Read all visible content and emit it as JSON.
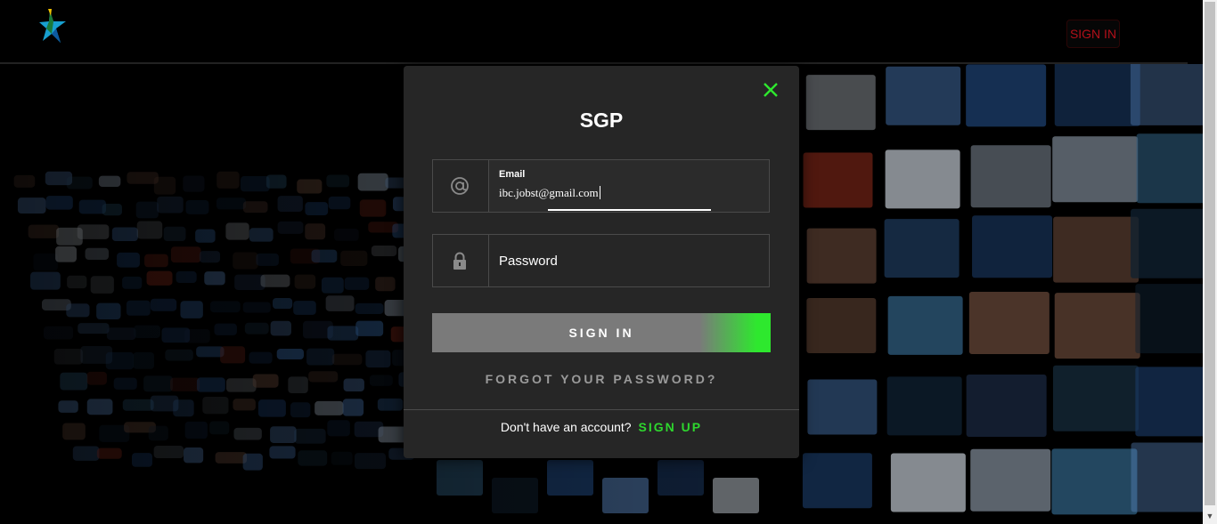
{
  "header": {
    "signin_label": "SIGN IN"
  },
  "modal": {
    "title": "SGP",
    "email": {
      "label": "Email",
      "value": "ibc.jobst@gmail.com",
      "icon": "at-icon"
    },
    "password": {
      "placeholder": "Password",
      "icon": "lock-icon"
    },
    "submit_label": "SIGN IN",
    "forgot_label": "FORGOT YOUR PASSWORD?",
    "signup_prompt": "Don't have an account?",
    "signup_label": "SIGN UP"
  },
  "colors": {
    "accent_green": "#2ee82e",
    "header_signin_red": "#b3101a",
    "modal_bg": "#262626"
  }
}
